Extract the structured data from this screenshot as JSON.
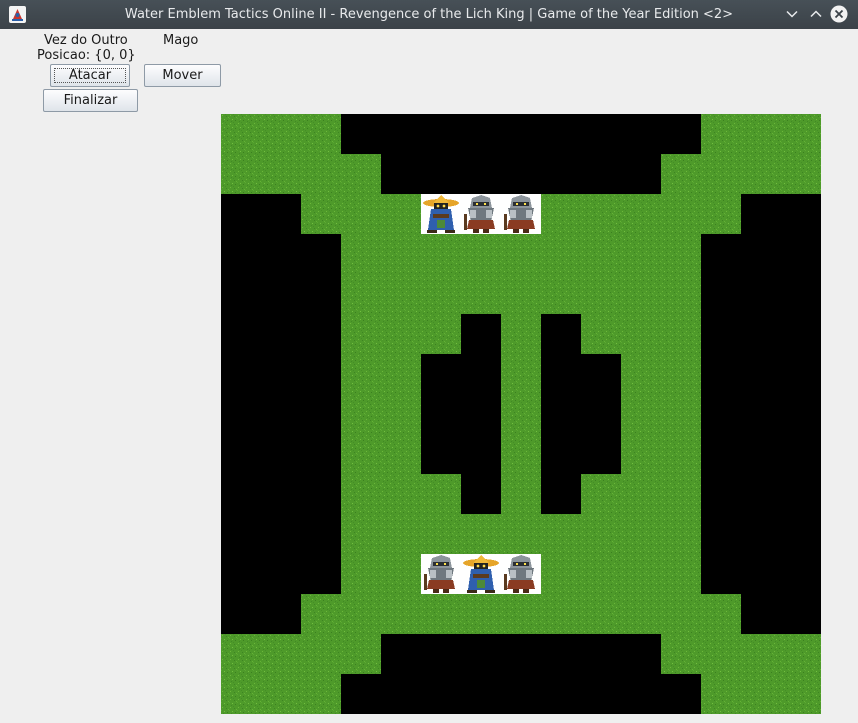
{
  "window": {
    "title": "Water Emblem Tactics Online II - Revengence of the Lich King | Game of the Year Edition <2>"
  },
  "status": {
    "turn": "Vez do Outro",
    "unit_class": "Mago",
    "position": "Posicao: {0, 0}"
  },
  "actions": {
    "attack": "Atacar",
    "move": "Mover",
    "end_turn": "Finalizar"
  },
  "colors": {
    "grass": "#4e9a2a",
    "wall": "#000000",
    "titlebar": "#3f464c"
  },
  "board": {
    "cols": 15,
    "rows": 15,
    "map": [
      "GG#########GG",
      "GGG#######GGG",
      "#GGGGGGGGGGG#",
      "##GGGGGGGGG##",
      "##GGGGGGGGG##",
      "##GGG#G#GGG##",
      "##GG##G##GG##",
      "##GG##G##GG##",
      "##GG##G##GG##",
      "##GGG#G#GGG##",
      "##GGGGGGGGG##",
      "##GGGGGGGGG##",
      "#GGGGGGGGGGG#",
      "GGG#######GGG",
      "GG#########GG"
    ],
    "units": [
      {
        "col": 5,
        "row": 2,
        "type": "mage"
      },
      {
        "col": 6,
        "row": 2,
        "type": "knight"
      },
      {
        "col": 7,
        "row": 2,
        "type": "knight"
      },
      {
        "col": 5,
        "row": 11,
        "type": "knight"
      },
      {
        "col": 6,
        "row": 11,
        "type": "mage"
      },
      {
        "col": 7,
        "row": 11,
        "type": "knight"
      }
    ]
  }
}
